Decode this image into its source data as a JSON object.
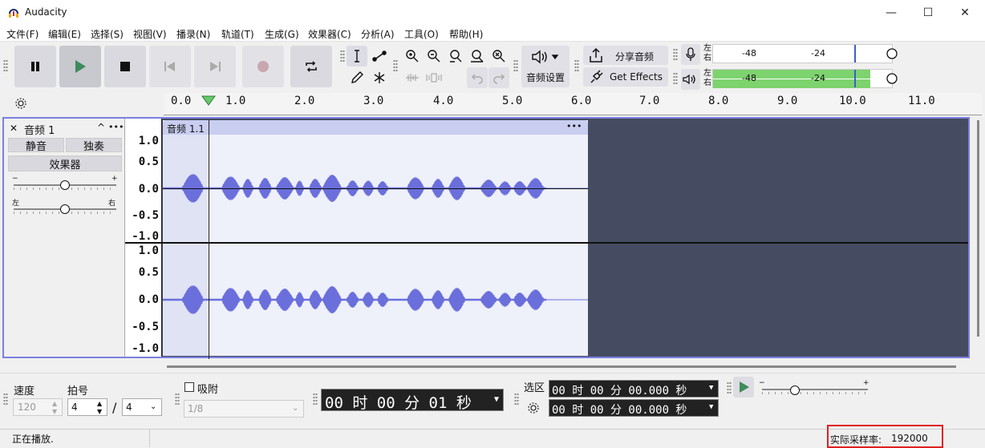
{
  "window": {
    "title": "Audacity",
    "minimize_glyph": "—",
    "maximize_glyph": "☐",
    "close_glyph": "✕"
  },
  "menu": [
    "文件(F)",
    "编辑(E)",
    "选择(S)",
    "视图(V)",
    "播录(N)",
    "轨道(T)",
    "生成(G)",
    "效果器(C)",
    "分析(A)",
    "工具(O)",
    "帮助(H)"
  ],
  "toolbar": {
    "audio_setup_label": "音频设置",
    "share_audio_label": "分享音频",
    "get_effects_label": "Get Effects",
    "record_meter": {
      "left": "左",
      "right": "右",
      "scale": [
        "-48",
        "-24"
      ]
    },
    "playback_meter": {
      "left": "左",
      "right": "右",
      "scale": [
        "-48",
        "-24"
      ],
      "level_fraction": 0.88
    }
  },
  "ruler": {
    "ticks": [
      "0.0",
      "1.0",
      "2.0",
      "3.0",
      "4.0",
      "5.0",
      "6.0",
      "7.0",
      "8.0",
      "9.0",
      "10.0",
      "11.0"
    ],
    "play_head_seconds": 0.4
  },
  "track": {
    "name": "音频 1",
    "mute_label": "静音",
    "solo_label": "独奏",
    "effects_label": "效果器",
    "gain_minus": "−",
    "gain_plus": "+",
    "pan_left": "左",
    "pan_right": "右",
    "clip_name": "音频 1.1",
    "clip_menu": "•••",
    "track_menu": "•••",
    "collapse": "^",
    "close": "✕",
    "vruler_top": [
      "1.0",
      "0.5",
      "0.0",
      "-0.5",
      "-1.0"
    ],
    "vruler_bottom": [
      "1.0",
      "0.5",
      "0.0",
      "-0.5",
      "-1.0"
    ]
  },
  "bottom": {
    "tempo_label": "速度",
    "tempo_value": "120",
    "meter_label": "拍号",
    "meter_num": "4",
    "meter_slash": "/",
    "meter_den": "4",
    "snap_label": "吸附",
    "snap_value": "1/8",
    "time_display": "00 时 00 分 01 秒",
    "selection_label": "选区",
    "selection_start": "00 时 00 分 00.000 秒",
    "selection_end": "00 时 00 分 00.000 秒",
    "speed_minus": "−",
    "speed_plus": "+"
  },
  "status": {
    "left": "正在播放.",
    "rate_label": "实际采样率:",
    "rate_value": "192000"
  },
  "colors": {
    "waveform": "#6a6fdc",
    "clip_bg": "#eef0fa",
    "track_bg": "#454b60",
    "meter_green": "#7dd36e",
    "play_green": "#3d8b5a",
    "highlight_red": "#e02020"
  }
}
